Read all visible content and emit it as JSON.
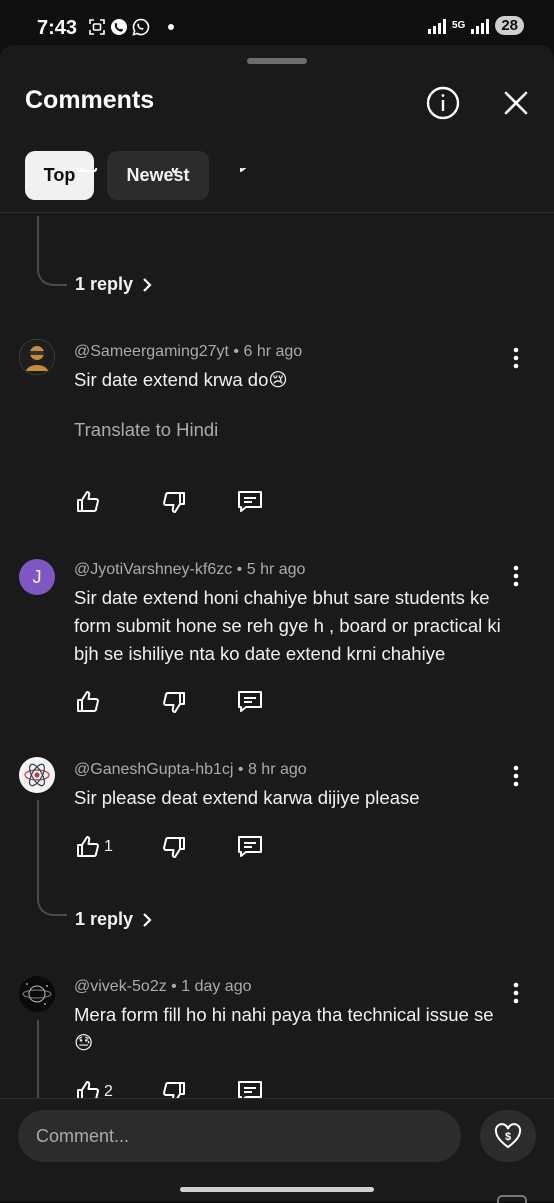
{
  "status": {
    "time": "7:43",
    "network": "5G",
    "battery": "28"
  },
  "header": {
    "title": "Comments"
  },
  "tabs": [
    {
      "label": "Top",
      "selected": true
    },
    {
      "label": "Newest",
      "selected": false
    }
  ],
  "comments": [
    {
      "reply_label": "1 reply"
    },
    {
      "author": "@Sameergaming27yt",
      "time": "6 hr ago",
      "text": "Sir date extend krwa do😢",
      "translate": "Translate to Hindi"
    },
    {
      "author": "@JyotiVarshney-kf6zc",
      "time": "5 hr ago",
      "text": "Sir date extend honi chahiye bhut sare students ke form submit hone se reh gye h , board or practical ki  bjh se ishiliye nta ko date extend krni chahiye",
      "avatar_letter": "J",
      "avatar_color": "#7e57c2"
    },
    {
      "author": "@GaneshGupta-hb1cj",
      "time": "8 hr ago",
      "text": "Sir please deat extend karwa dijiye please",
      "likes": "1",
      "reply_label": "1 reply"
    },
    {
      "author": "@vivek-5o2z",
      "time": "1 day ago",
      "text": "Mera form fill ho hi nahi paya tha technical issue se 😓",
      "likes": "2"
    }
  ],
  "composer": {
    "placeholder": "Comment..."
  },
  "colors": {
    "background": "#0f0f0f",
    "sheet": "#1a1a1a",
    "secondary_text": "#aaaaaa",
    "chip_selected": "#f1f1f1"
  }
}
